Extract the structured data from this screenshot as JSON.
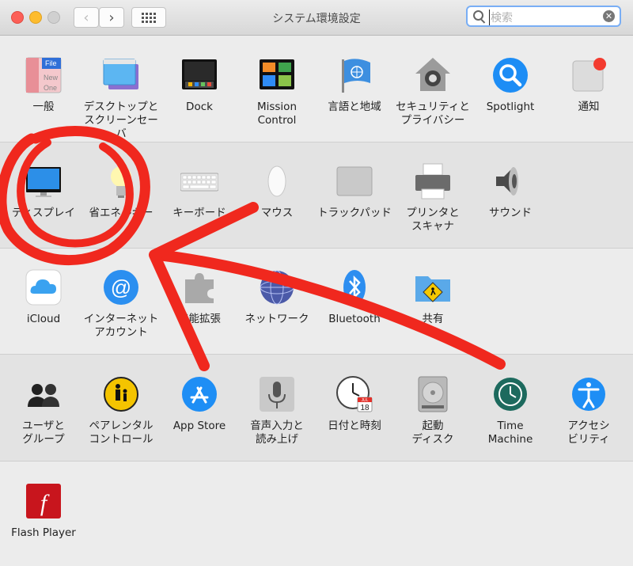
{
  "window": {
    "title": "システム環境設定"
  },
  "search": {
    "placeholder": "検索"
  },
  "rows": [
    [
      {
        "label": "一般",
        "icon": "general-icon"
      },
      {
        "label": "デスクトップと\nスクリーンセーバ",
        "icon": "desktop-screensaver-icon"
      },
      {
        "label": "Dock",
        "icon": "dock-icon"
      },
      {
        "label": "Mission\nControl",
        "icon": "mission-control-icon"
      },
      {
        "label": "言語と地域",
        "icon": "language-region-icon"
      },
      {
        "label": "セキュリティと\nプライバシー",
        "icon": "security-privacy-icon"
      },
      {
        "label": "Spotlight",
        "icon": "spotlight-icon"
      },
      {
        "label": "通知",
        "icon": "notifications-icon"
      }
    ],
    [
      {
        "label": "ディスプレイ",
        "icon": "display-icon"
      },
      {
        "label": "省エネルギー",
        "icon": "energy-saver-icon"
      },
      {
        "label": "キーボード",
        "icon": "keyboard-icon"
      },
      {
        "label": "マウス",
        "icon": "mouse-icon"
      },
      {
        "label": "トラックパッド",
        "icon": "trackpad-icon"
      },
      {
        "label": "プリンタと\nスキャナ",
        "icon": "printer-scanner-icon"
      },
      {
        "label": "サウンド",
        "icon": "sound-icon"
      }
    ],
    [
      {
        "label": "iCloud",
        "icon": "icloud-icon"
      },
      {
        "label": "インターネット\nアカウント",
        "icon": "internet-accounts-icon"
      },
      {
        "label": "機能拡張",
        "icon": "extensions-icon"
      },
      {
        "label": "ネットワーク",
        "icon": "network-icon"
      },
      {
        "label": "Bluetooth",
        "icon": "bluetooth-icon"
      },
      {
        "label": "共有",
        "icon": "sharing-icon"
      }
    ],
    [
      {
        "label": "ユーザと\nグループ",
        "icon": "users-groups-icon"
      },
      {
        "label": "ペアレンタル\nコントロール",
        "icon": "parental-controls-icon"
      },
      {
        "label": "App Store",
        "icon": "app-store-icon"
      },
      {
        "label": "音声入力と\n読み上げ",
        "icon": "dictation-speech-icon"
      },
      {
        "label": "日付と時刻",
        "icon": "date-time-icon"
      },
      {
        "label": "起動\nディスク",
        "icon": "startup-disk-icon"
      },
      {
        "label": "Time\nMachine",
        "icon": "time-machine-icon"
      },
      {
        "label": "アクセシ\nビリティ",
        "icon": "accessibility-icon"
      }
    ],
    [
      {
        "label": "Flash Player",
        "icon": "flash-player-icon"
      }
    ]
  ],
  "icon_text": {
    "general_file": "File",
    "general_new": "New",
    "general_one": "One",
    "calendar_month": "JUL",
    "calendar_day": "18",
    "parental_label": "ペアレンタル",
    "flash_glyph": "f"
  },
  "colors": {
    "annotation": "#f0281e",
    "search_focus": "#79aef5",
    "close": "#fc5f57",
    "minimize": "#fdbc2e"
  }
}
